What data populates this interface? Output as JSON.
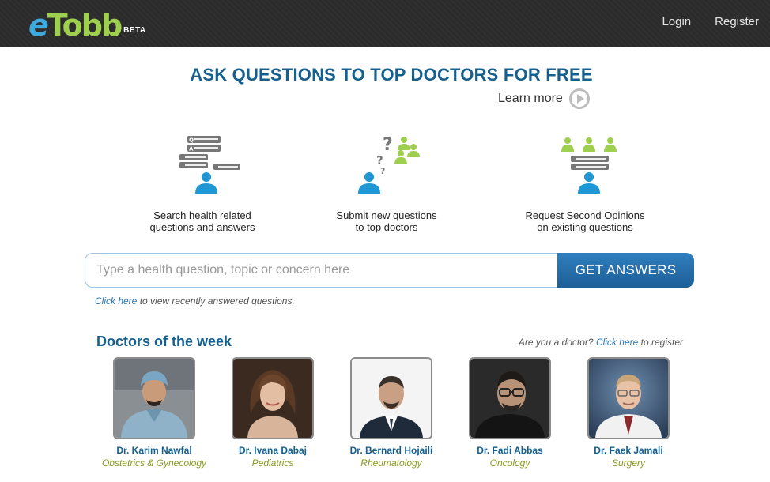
{
  "header": {
    "logo": {
      "e": "e",
      "rest": "Tobb",
      "badge": "BETA"
    },
    "nav": [
      {
        "label": "Login"
      },
      {
        "label": "Register"
      }
    ]
  },
  "hero": {
    "title": "ASK QUESTIONS TO TOP DOCTORS FOR FREE",
    "learn_more": "Learn more"
  },
  "features": [
    {
      "line1": "Search health related",
      "line2": "questions and answers",
      "icon": "qa-search-icon"
    },
    {
      "line1": "Submit new questions",
      "line2": "to top doctors",
      "icon": "ask-doctors-icon"
    },
    {
      "line1": "Request Second Opinions",
      "line2": "on existing questions",
      "icon": "second-opinion-icon"
    }
  ],
  "search": {
    "placeholder": "Type a health question, topic or concern here",
    "value": "",
    "button": "GET ANSWERS"
  },
  "recent": {
    "link": "Click here",
    "text": " to view recently answered questions."
  },
  "doctors_section": {
    "title": "Doctors of the week",
    "register_prompt": "Are you a doctor? ",
    "register_link": "Click here",
    "register_suffix": " to register"
  },
  "doctors": [
    {
      "name": "Dr. Karim Nawfal",
      "specialty": "Obstetrics & Gynecology"
    },
    {
      "name": "Dr. Ivana Dabaj",
      "specialty": "Pediatrics"
    },
    {
      "name": "Dr. Bernard Hojaili",
      "specialty": "Rheumatology"
    },
    {
      "name": "Dr. Fadi Abbas",
      "specialty": "Oncology"
    },
    {
      "name": "Dr. Faek Jamali",
      "specialty": "Surgery"
    }
  ],
  "colors": {
    "brand_blue": "#16608f",
    "brand_green": "#9fcf4e",
    "person_blue": "#1e97d4",
    "topbar": "#2b2b2b"
  }
}
